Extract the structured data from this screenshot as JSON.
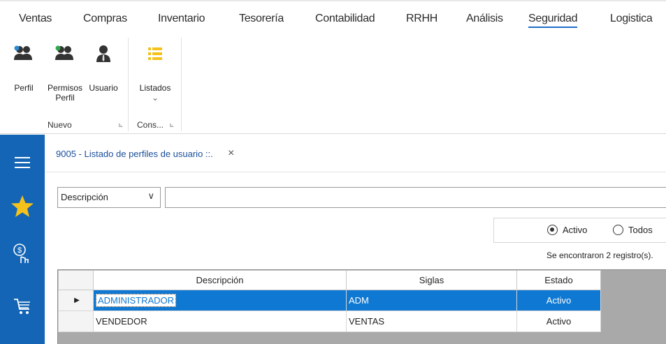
{
  "menu": {
    "items": [
      "Ventas",
      "Compras",
      "Inventario",
      "Tesorería",
      "Contabilidad",
      "RRHH",
      "Análisis",
      "Seguridad",
      "Logistica"
    ],
    "active": "Seguridad"
  },
  "ribbon": {
    "buttons": {
      "perfil": "Perfil",
      "permisos_line1": "Permisos",
      "permisos_line2": "Perfil",
      "usuario": "Usuario",
      "listados": "Listados",
      "listados_arrow": "⌄"
    },
    "groups": {
      "nuevo": "Nuevo",
      "consultas": "Cons..."
    },
    "launcher_glyph": "⊾"
  },
  "sidebar": {
    "icons": [
      "menu-icon",
      "star-icon",
      "money-hand-icon",
      "cart-icon"
    ]
  },
  "tab": {
    "label": "9005 - Listado de perfiles de usuario ::.",
    "close": "×"
  },
  "filter": {
    "field_selected": "Descripción",
    "arrow": "∨",
    "search_value": "",
    "search_placeholder": ""
  },
  "status_filter": {
    "options": [
      "Activo",
      "Todos"
    ],
    "selected": "Activo"
  },
  "records_text": "Se encontraron 2 registro(s).",
  "table": {
    "columns": [
      "Descripción",
      "Siglas",
      "Estado"
    ],
    "rows": [
      {
        "descripcion": "ADMINISTRADOR",
        "siglas": "ADM",
        "estado": "Activo",
        "selected": true,
        "indicator": "▶"
      },
      {
        "descripcion": "VENDEDOR",
        "siglas": "VENTAS",
        "estado": "Activo",
        "selected": false,
        "indicator": ""
      }
    ]
  },
  "colors": {
    "sidebar": "#1465b5",
    "selection": "#0f78d2",
    "ribbon_icon_yellow": "#f4c21a",
    "accent_green": "#2ea84a",
    "accent_blue": "#2a8ad8"
  }
}
